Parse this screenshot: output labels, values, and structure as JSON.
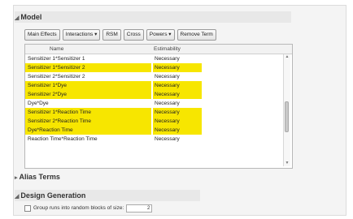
{
  "model_section": {
    "title": "Model",
    "disclosure": "◢"
  },
  "toolbar": {
    "main_effects": "Main Effects",
    "interactions": "Interactions ▾",
    "rsm": "RSM",
    "cross": "Cross",
    "powers": "Powers ▾",
    "remove_term": "Remove Term"
  },
  "table": {
    "headers": [
      "Name",
      "Estimability"
    ],
    "rows": [
      {
        "name": "Sensitizer 1*Sensitizer 1",
        "estimability": "Necessary",
        "highlighted": false
      },
      {
        "name": "Sensitizer 1*Sensitizer 2",
        "estimability": "Necessary",
        "highlighted": true
      },
      {
        "name": "Sensitizer 2*Sensitizer 2",
        "estimability": "Necessary",
        "highlighted": false
      },
      {
        "name": "Sensitizer 1*Dye",
        "estimability": "Necessary",
        "highlighted": true
      },
      {
        "name": "Sensitizer 2*Dye",
        "estimability": "Necessary",
        "highlighted": true
      },
      {
        "name": "Dye*Dye",
        "estimability": "Necessary",
        "highlighted": false
      },
      {
        "name": "Sensitizer 1*Reaction Time",
        "estimability": "Necessary",
        "highlighted": true
      },
      {
        "name": "Sensitizer 2*Reaction Time",
        "estimability": "Necessary",
        "highlighted": true
      },
      {
        "name": "Dye*Reaction Time",
        "estimability": "Necessary",
        "highlighted": true
      },
      {
        "name": "Reaction Time*Reaction Time",
        "estimability": "Necessary",
        "highlighted": false
      }
    ]
  },
  "alias_section": {
    "title": "Alias Terms",
    "disclosure": "▸"
  },
  "design_section": {
    "title": "Design Generation",
    "disclosure": "◢"
  },
  "group_runs": {
    "label": "Group runs into random blocks of size:",
    "value": "2"
  },
  "colors": {
    "highlight": "#f7e600"
  }
}
